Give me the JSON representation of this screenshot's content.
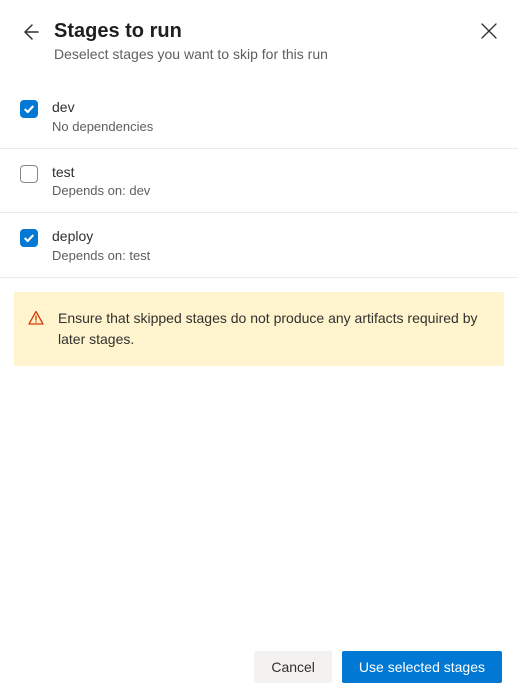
{
  "header": {
    "title": "Stages to run",
    "subtitle": "Deselect stages you want to skip for this run"
  },
  "stages": [
    {
      "name": "dev",
      "dependency": "No dependencies",
      "checked": true
    },
    {
      "name": "test",
      "dependency": "Depends on: dev",
      "checked": false
    },
    {
      "name": "deploy",
      "dependency": "Depends on: test",
      "checked": true
    }
  ],
  "alert": {
    "message": "Ensure that skipped stages do not produce any artifacts required by later stages."
  },
  "footer": {
    "cancel": "Cancel",
    "confirm": "Use selected stages"
  },
  "colors": {
    "primary": "#0078d4",
    "alertBg": "#fff4ce",
    "warningIcon": "#d83b01"
  }
}
